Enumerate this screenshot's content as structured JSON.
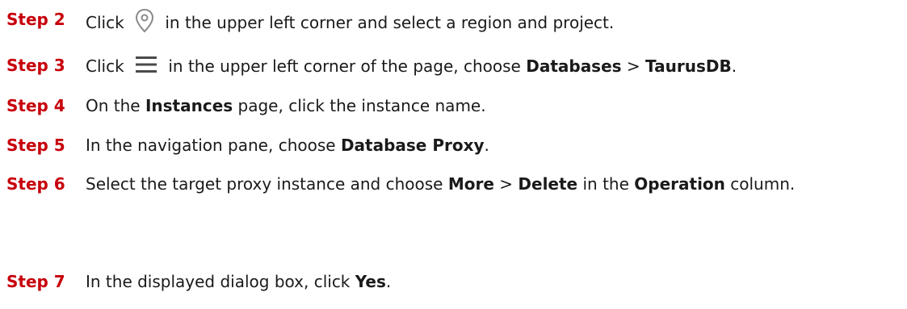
{
  "steps": [
    {
      "label": "Step 2",
      "parts": [
        "Click",
        "in the upper left corner and select a region and project."
      ],
      "icon": "location-pin-icon"
    },
    {
      "label": "Step 3",
      "parts": [
        "Click",
        "in the upper left corner of the page, choose",
        "Databases",
        ">",
        "TaurusDB",
        "."
      ],
      "icon": "hamburger-menu-icon"
    },
    {
      "label": "Step 4",
      "parts": [
        "On the",
        "Instances",
        "page, click the instance name."
      ]
    },
    {
      "label": "Step 5",
      "parts": [
        "In the navigation pane, choose",
        "Database Proxy",
        "."
      ]
    },
    {
      "label": "Step 6",
      "parts": [
        "Select the target proxy instance and choose",
        "More",
        ">",
        "Delete",
        "in the",
        "Operation",
        "column."
      ]
    },
    {
      "label": "Step 7",
      "parts": [
        "In the displayed dialog box, click",
        "Yes",
        "."
      ]
    }
  ],
  "colors": {
    "step_label": "#c7000b",
    "text": "#1a1a1a",
    "icon": "#8a8a8a"
  }
}
